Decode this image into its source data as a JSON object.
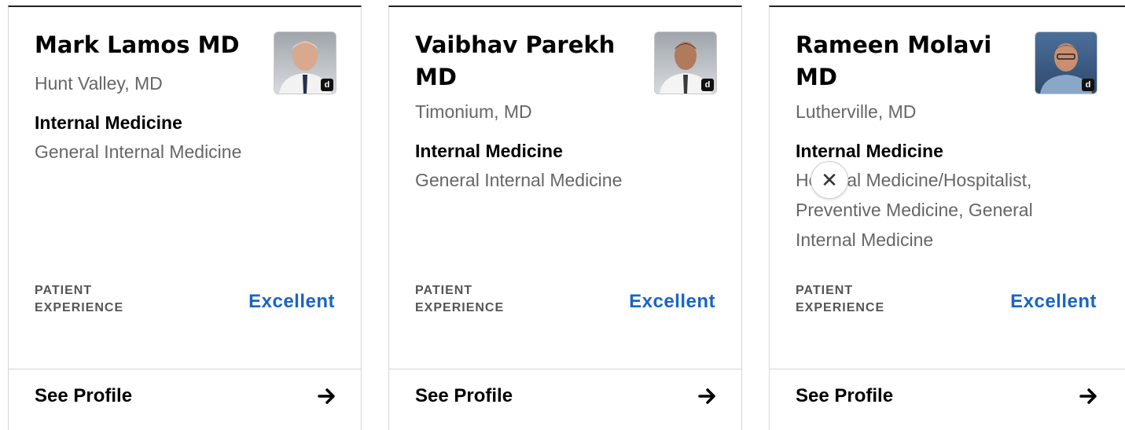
{
  "cards": [
    {
      "name": "Mark Lamos MD",
      "location": "Hunt Valley, MD",
      "specialty": "Internal Medicine",
      "subspecialties": "General Internal Medicine",
      "patient_experience_label": "PATIENT EXPERIENCE",
      "patient_experience_value": "Excellent",
      "cta": "See Profile",
      "photo_badge": "d"
    },
    {
      "name": "Vaibhav Parekh MD",
      "location": "Timonium, MD",
      "specialty": "Internal Medicine",
      "subspecialties": "General Internal Medicine",
      "patient_experience_label": "PATIENT EXPERIENCE",
      "patient_experience_value": "Excellent",
      "cta": "See Profile",
      "photo_badge": "d"
    },
    {
      "name": "Rameen Molavi MD",
      "location": "Lutherville, MD",
      "specialty": "Internal Medicine",
      "subspecialties": "Hospital Medicine/Hospitalist, Preventive Medicine, General Internal Medicine",
      "patient_experience_label": "PATIENT EXPERIENCE",
      "patient_experience_value": "Excellent",
      "cta": "See Profile",
      "photo_badge": "d"
    }
  ],
  "close_button": {
    "icon": "close-icon",
    "glyph": "✕"
  },
  "colors": {
    "accent": "#1a64c6",
    "text": "#000000",
    "muted": "#666666",
    "divider": "#d6d6d6"
  }
}
